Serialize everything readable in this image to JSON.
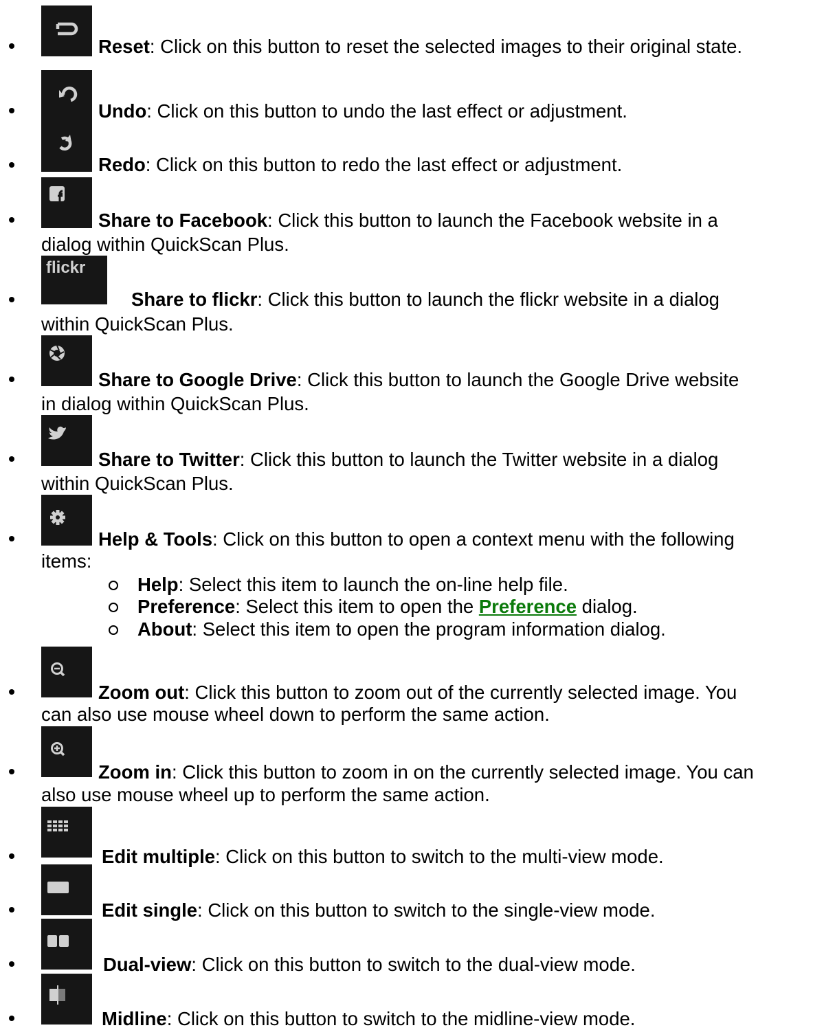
{
  "items": [
    {
      "label": "Reset",
      "desc": ": Click on this button to reset the selected images to their original state.",
      "icon": "reset-icon"
    },
    {
      "label": "Undo",
      "desc": ": Click on this button to undo the last effect or adjustment.",
      "icon": "undo-icon"
    },
    {
      "label": "Redo",
      "desc": ": Click on this button to redo the last effect or adjustment.",
      "icon": "redo-icon"
    },
    {
      "label": "Share to Facebook",
      "desc": ": Click this button to launch the Facebook website in a",
      "cont": "dialog within QuickScan Plus.",
      "icon": "facebook-icon"
    },
    {
      "label": "Share to flickr",
      "desc": ": Click this button to launch the flickr website in a dialog",
      "cont": "within QuickScan Plus.",
      "icon": "flickr-icon",
      "icon_text": "flickr"
    },
    {
      "label": "Share to Google Drive",
      "desc": ": Click this button to launch the Google Drive website",
      "cont": "in dialog within QuickScan Plus.",
      "icon": "google-drive-icon"
    },
    {
      "label": "Share to Twitter",
      "desc": ": Click this button to launch the Twitter website in a dialog",
      "cont": "within QuickScan Plus.",
      "icon": "twitter-icon"
    },
    {
      "label": "Help & Tools",
      "desc": ": Click on this button to open a context menu with the following",
      "cont": "items:",
      "icon": "gear-icon"
    },
    {
      "label": "Zoom out",
      "desc": ": Click this button to zoom out of the currently selected image. You",
      "cont": "can also use mouse wheel down to perform the same action.",
      "icon": "zoom-out-icon"
    },
    {
      "label": "Zoom in",
      "desc": ": Click this button to zoom in on the currently selected image. You can",
      "cont": "also use mouse wheel up to perform the same action.",
      "icon": "zoom-in-icon"
    },
    {
      "label": "Edit multiple",
      "desc": ": Click on this button to switch to the multi-view mode.",
      "icon": "grid-icon"
    },
    {
      "label": "Edit single",
      "desc": ": Click on this button to switch to the single-view mode.",
      "icon": "single-view-icon"
    },
    {
      "label": "Dual-view",
      "desc": ": Click on this button to switch to the dual-view mode.",
      "icon": "dual-view-icon"
    },
    {
      "label": "Midline",
      "desc": ": Click on this button to switch to the midline-view mode.",
      "icon": "midline-icon"
    }
  ],
  "subitems": [
    {
      "label": "Help",
      "desc": ": Select this item to launch the on-line help file."
    },
    {
      "label": "Preference",
      "pre": ": Select this item to open the ",
      "link": "Preference",
      "post": " dialog."
    },
    {
      "label": "About",
      "desc": ": Select this item to open the program information dialog."
    }
  ],
  "colors": {
    "icon_bg": "#161616",
    "icon_fg": "#d0d0d0",
    "link": "#0b7a0b"
  }
}
